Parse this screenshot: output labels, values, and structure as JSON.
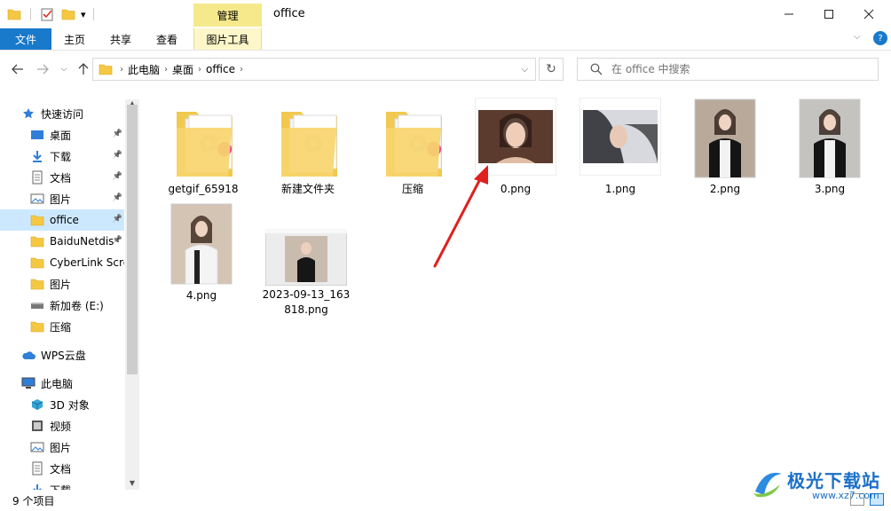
{
  "window": {
    "title": "office",
    "context_tab": "管理",
    "quick_access_dropdown": "▾"
  },
  "ribbon": {
    "tabs": [
      "文件",
      "主页",
      "共享",
      "查看",
      "图片工具"
    ]
  },
  "address": {
    "segments": [
      "此电脑",
      "桌面",
      "office"
    ]
  },
  "search": {
    "placeholder": "在 office 中搜索"
  },
  "sidebar": {
    "items": [
      {
        "label": "快速访问",
        "icon": "star-icon",
        "pinned": false
      },
      {
        "label": "桌面",
        "icon": "desktop-icon",
        "pinned": true
      },
      {
        "label": "下载",
        "icon": "download-icon",
        "pinned": true
      },
      {
        "label": "文档",
        "icon": "document-icon",
        "pinned": true
      },
      {
        "label": "图片",
        "icon": "picture-icon",
        "pinned": true
      },
      {
        "label": "office",
        "icon": "folder-icon",
        "pinned": true,
        "selected": true
      },
      {
        "label": "BaiduNetdis",
        "icon": "folder-icon",
        "pinned": true
      },
      {
        "label": "CyberLink Scre",
        "icon": "folder-icon",
        "pinned": false
      },
      {
        "label": "图片",
        "icon": "folder-icon",
        "pinned": false
      },
      {
        "label": "新加卷 (E:)",
        "icon": "drive-icon",
        "pinned": false
      },
      {
        "label": "压缩",
        "icon": "folder-icon",
        "pinned": false
      },
      {
        "label": "WPS云盘",
        "icon": "cloud-icon",
        "pinned": false
      },
      {
        "label": "此电脑",
        "icon": "computer-icon",
        "pinned": false
      },
      {
        "label": "3D 对象",
        "icon": "cube-icon",
        "pinned": false
      },
      {
        "label": "视频",
        "icon": "video-icon",
        "pinned": false
      },
      {
        "label": "图片",
        "icon": "picture-icon",
        "pinned": false
      },
      {
        "label": "文档",
        "icon": "document-icon",
        "pinned": false
      },
      {
        "label": "下载",
        "icon": "download-icon",
        "pinned": false
      }
    ]
  },
  "files": [
    {
      "name": "getgif_65918",
      "type": "folder"
    },
    {
      "name": "新建文件夹",
      "type": "folder"
    },
    {
      "name": "压缩",
      "type": "folder"
    },
    {
      "name": "0.png",
      "type": "image"
    },
    {
      "name": "1.png",
      "type": "image"
    },
    {
      "name": "2.png",
      "type": "image"
    },
    {
      "name": "3.png",
      "type": "image"
    },
    {
      "name": "4.png",
      "type": "image"
    },
    {
      "name": "2023-09-13_163818.png",
      "type": "image",
      "name_line1": "2023-09-13_163",
      "name_line2": "818.png"
    }
  ],
  "status": {
    "item_count": "9 个项目"
  },
  "watermark": {
    "text": "极光下载站",
    "url": "www.xz7.com"
  },
  "colors": {
    "accent": "#1979ca",
    "selection": "#cce8ff",
    "context_tab": "#f6e98b",
    "arrow": "#e0201e"
  }
}
